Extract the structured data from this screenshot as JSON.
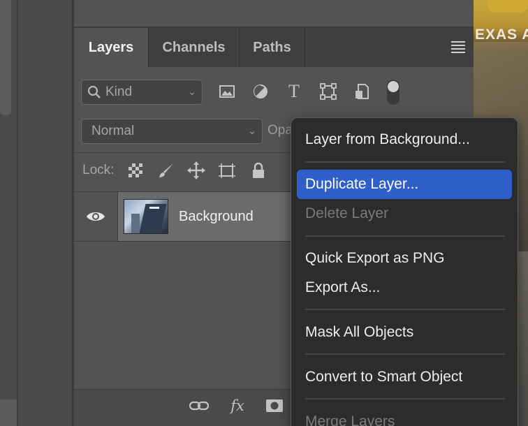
{
  "tabs": [
    {
      "label": "Layers",
      "active": true
    },
    {
      "label": "Channels",
      "active": false
    },
    {
      "label": "Paths",
      "active": false
    }
  ],
  "filter": {
    "kind_label": "Kind",
    "icons": [
      "image-filter-icon",
      "adjustment-filter-icon",
      "type-filter-icon",
      "shape-filter-icon",
      "smart-object-filter-icon"
    ]
  },
  "blend_mode": "Normal",
  "opacity_label_partial": "Opa",
  "lock": {
    "label": "Lock:",
    "icons": [
      "lock-transparent-pixels-icon",
      "lock-image-pixels-icon",
      "lock-position-icon",
      "lock-artboard-icon",
      "lock-all-icon"
    ]
  },
  "layers": [
    {
      "name": "Background",
      "visible": true
    }
  ],
  "bottom_icons": [
    "link-icon",
    "fx-icon",
    "mask-icon"
  ],
  "bottom_fx_label": "fx",
  "photo_text": "EXAS A",
  "context_menu": {
    "items": [
      {
        "label": "Layer from Background...",
        "state": "normal"
      },
      {
        "label": "Duplicate Layer...",
        "state": "highlighted"
      },
      {
        "label": "Delete Layer",
        "state": "disabled"
      },
      {
        "label": "Quick Export as PNG",
        "state": "normal"
      },
      {
        "label": "Export As...",
        "state": "normal"
      },
      {
        "label": "Mask All Objects",
        "state": "normal"
      },
      {
        "label": "Convert to Smart Object",
        "state": "normal"
      },
      {
        "label": "Merge Layers",
        "state": "disabled"
      }
    ],
    "highlight_color": "#2f5fc9"
  }
}
